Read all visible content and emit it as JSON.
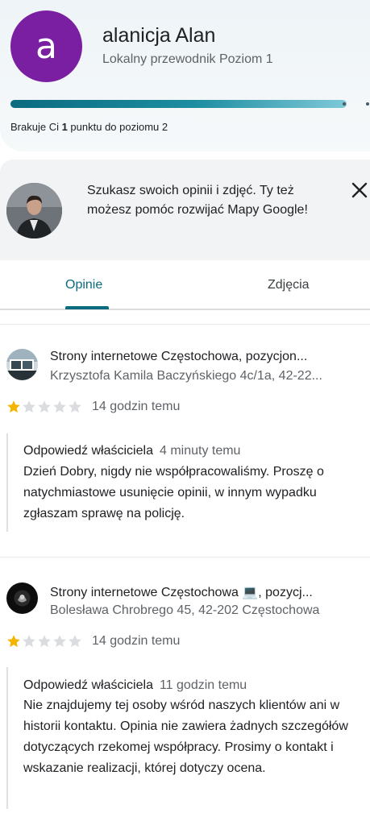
{
  "profile": {
    "avatar_letter": "a",
    "avatar_color": "#7b1fa2",
    "name": "alanicja Alan",
    "level_text": "Lokalny przewodnik Poziom 1",
    "progress_fraction": 0.935,
    "points_prefix": "Brakuje Ci ",
    "points_value": "1",
    "points_suffix": " punktu do poziomu 2"
  },
  "promo": {
    "text": "Szukasz swoich opinii i zdjęć. Ty też możesz pomóc rozwijać Mapy Google!",
    "close_icon": "close-icon"
  },
  "tabs": [
    {
      "label": "Opinie",
      "active": true
    },
    {
      "label": "Zdjęcia",
      "active": false
    }
  ],
  "accent_color": "#0b6b80",
  "star_color": "#f4b400",
  "reviews": [
    {
      "business_name": "Strony internetowe Częstochowa, pozycjon...",
      "address": "Krzysztofa Kamila Baczyńskiego 4c/1a, 42-22...",
      "rating": 1,
      "time": "14 godzin temu",
      "reply_label": "Odpowiedź właściciela",
      "reply_time": "4 minuty temu",
      "reply_text": "Dzień Dobry, nigdy nie współpracowaliśmy. Proszę o natychmiastowe usunięcie opinii, w innym wypadku zgłaszam sprawę na policję."
    },
    {
      "business_name": "Strony internetowe Częstochowa 💻, pozycj...",
      "address": "Bolesława Chrobrego 45, 42-202 Częstochowa",
      "rating": 1,
      "time": "14 godzin temu",
      "reply_label": "Odpowiedź właściciela",
      "reply_time": "11 godzin temu",
      "reply_text": "Nie znajdujemy tej osoby wśród naszych klientów ani w historii kontaktu. Opinia nie zawiera żadnych szczegółów dotyczących rzekomej współpracy. Prosimy o kontakt i wskazanie realizacji, której dotyczy ocena."
    }
  ]
}
